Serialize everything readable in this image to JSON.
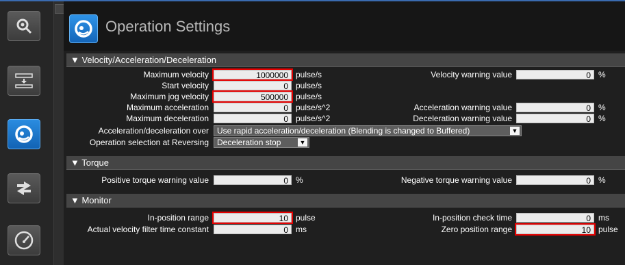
{
  "header": {
    "title": "Operation Settings"
  },
  "sidebar": {
    "items": [
      {
        "icon": "gear-search-icon"
      },
      {
        "icon": "ruler-arrows-icon"
      },
      {
        "icon": "operation-settings-icon",
        "active": true
      },
      {
        "icon": "swap-arrows-icon"
      },
      {
        "icon": "speedometer-icon"
      }
    ]
  },
  "velocity": {
    "section_title": "▼ Velocity/Acceleration/Deceleration",
    "max_velocity": {
      "label": "Maximum velocity",
      "value": "1000000",
      "unit": "pulse/s"
    },
    "start_velocity": {
      "label": "Start velocity",
      "value": "0",
      "unit": "pulse/s"
    },
    "max_jog_velocity": {
      "label": "Maximum jog velocity",
      "value": "500000",
      "unit": "pulse/s"
    },
    "max_acceleration": {
      "label": "Maximum acceleration",
      "value": "0",
      "unit": "pulse/s^2"
    },
    "max_deceleration": {
      "label": "Maximum deceleration",
      "value": "0",
      "unit": "pulse/s^2"
    },
    "velocity_warning": {
      "label": "Velocity warning value",
      "value": "0",
      "unit": "%"
    },
    "acceleration_warning": {
      "label": "Acceleration warning value",
      "value": "0",
      "unit": "%"
    },
    "deceleration_warning": {
      "label": "Deceleration warning value",
      "value": "0",
      "unit": "%"
    },
    "accel_decel_over": {
      "label": "Acceleration/deceleration over",
      "value": "Use rapid acceleration/deceleration (Blending is changed to Buffered)"
    },
    "reversing": {
      "label": "Operation selection at Reversing",
      "value": "Deceleration stop"
    }
  },
  "torque": {
    "section_title": "▼ Torque",
    "positive_warning": {
      "label": "Positive torque warning value",
      "value": "0",
      "unit": "%"
    },
    "negative_warning": {
      "label": "Negative torque warning value",
      "value": "0",
      "unit": "%"
    }
  },
  "monitor": {
    "section_title": "▼ Monitor",
    "in_position_range": {
      "label": "In-position range",
      "value": "10",
      "unit": "pulse"
    },
    "velocity_filter": {
      "label": "Actual velocity filter time constant",
      "value": "0",
      "unit": "ms"
    },
    "in_position_check_time": {
      "label": "In-position check time",
      "value": "0",
      "unit": "ms"
    },
    "zero_position_range": {
      "label": "Zero position range",
      "value": "10",
      "unit": "pulse"
    }
  },
  "colors": {
    "highlight": "#e60000",
    "accent": "#1a7ad0"
  }
}
